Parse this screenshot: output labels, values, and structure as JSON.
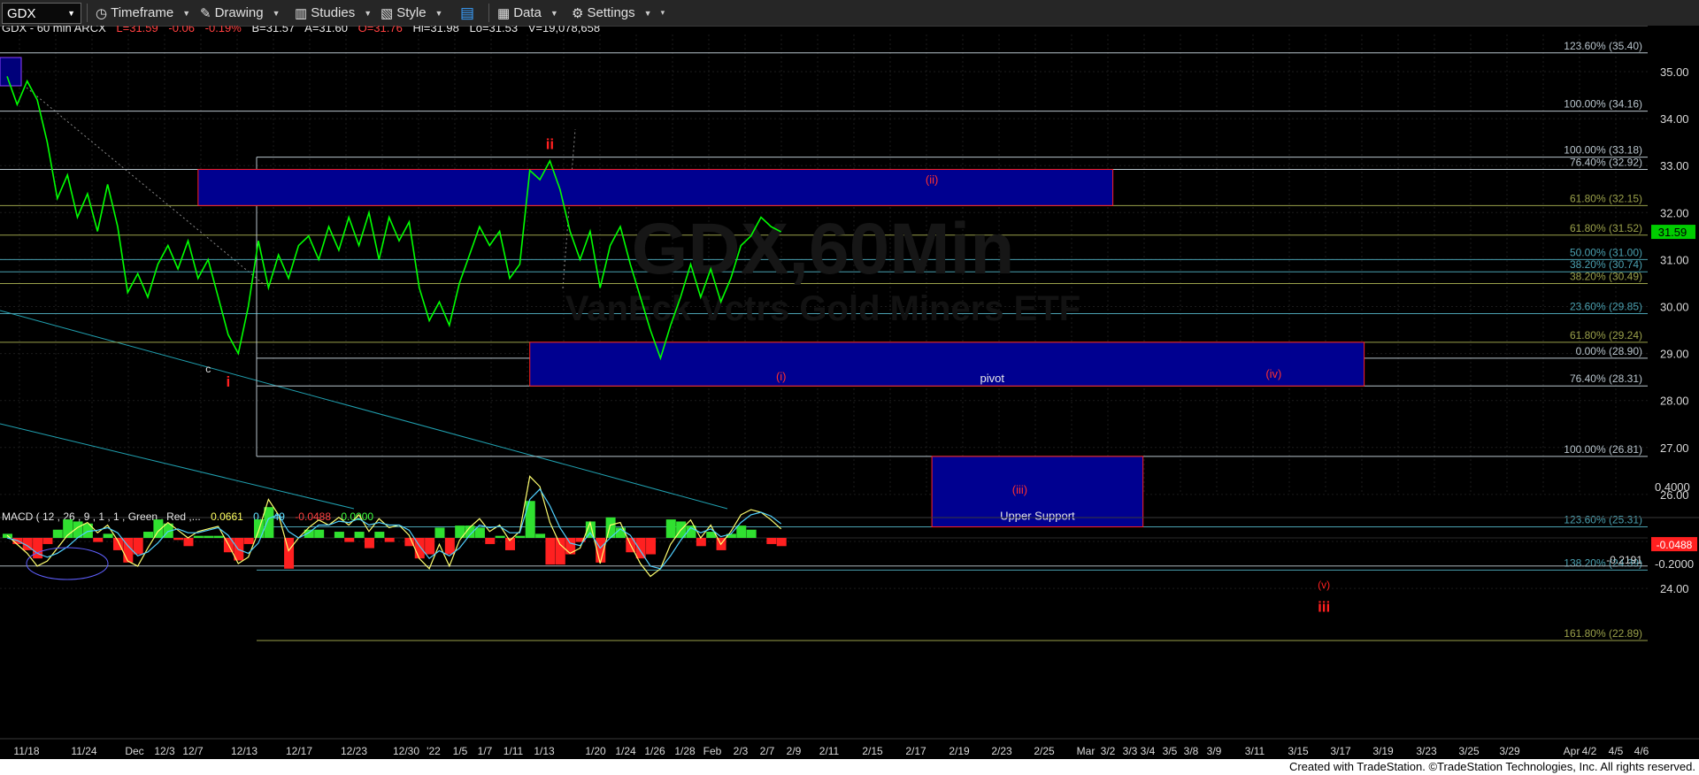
{
  "toolbar": {
    "symbol": "GDX",
    "timeframe_label": "Timeframe",
    "drawing_label": "Drawing",
    "studies_label": "Studies",
    "style_label": "Style",
    "data_label": "Data",
    "settings_label": "Settings"
  },
  "header": {
    "name": "GDX - 60 min  ARCX",
    "last": "L=31.59",
    "change": "-0.06",
    "change_pct": "-0.19%",
    "bid": "B=31.57",
    "ask": "A=31.60",
    "open": "O=31.76",
    "high": "Hi=31.98",
    "low": "Lo=31.53",
    "volume": "V=19,078,658"
  },
  "watermark": {
    "line1": "GDX,60Min",
    "line2": "VanEck Vctrs Gold Miners ETF"
  },
  "colors": {
    "price": "#00ff00",
    "zone_fill": "#000090",
    "zone_border": "#ff2020",
    "wave_label": "#ff2020",
    "last_badge": "#00cc00"
  },
  "chart_data": {
    "type": "line",
    "title": "GDX - 60 min",
    "price_ticks": [
      "35.00",
      "34.00",
      "33.00",
      "32.00",
      "31.00",
      "30.00",
      "29.00",
      "28.00",
      "27.00",
      "26.00",
      "25.00",
      "24.00"
    ],
    "ylim": [
      22.6,
      35.7
    ],
    "last_price": "31.59",
    "x_ticks": [
      "11/18",
      "11/24",
      "Dec",
      "12/3",
      "12/7",
      "12/13",
      "12/17",
      "12/23",
      "12/30",
      "'22",
      "1/5",
      "1/7",
      "1/11",
      "1/13",
      "1/20",
      "1/24",
      "1/26",
      "1/28",
      "Feb",
      "2/3",
      "2/7",
      "2/9",
      "2/11",
      "2/15",
      "2/17",
      "2/19",
      "2/23",
      "2/25",
      "Mar",
      "3/2",
      "3/3",
      "3/4",
      "3/5",
      "3/8",
      "3/9",
      "3/11",
      "3/15",
      "3/17",
      "3/19",
      "3/23",
      "3/25",
      "3/29",
      "Apr",
      "4/2",
      "4/5",
      "4/6"
    ],
    "price_series": [
      {
        "t": 0,
        "v": 34.9
      },
      {
        "t": 1,
        "v": 34.3
      },
      {
        "t": 2,
        "v": 34.8
      },
      {
        "t": 3,
        "v": 34.4
      },
      {
        "t": 4,
        "v": 33.5
      },
      {
        "t": 5,
        "v": 32.3
      },
      {
        "t": 6,
        "v": 32.8
      },
      {
        "t": 7,
        "v": 31.9
      },
      {
        "t": 8,
        "v": 32.4
      },
      {
        "t": 9,
        "v": 31.6
      },
      {
        "t": 10,
        "v": 32.6
      },
      {
        "t": 11,
        "v": 31.7
      },
      {
        "t": 12,
        "v": 30.3
      },
      {
        "t": 13,
        "v": 30.7
      },
      {
        "t": 14,
        "v": 30.2
      },
      {
        "t": 15,
        "v": 30.9
      },
      {
        "t": 16,
        "v": 31.3
      },
      {
        "t": 17,
        "v": 30.8
      },
      {
        "t": 18,
        "v": 31.4
      },
      {
        "t": 19,
        "v": 30.6
      },
      {
        "t": 20,
        "v": 31.0
      },
      {
        "t": 21,
        "v": 30.2
      },
      {
        "t": 22,
        "v": 29.4
      },
      {
        "t": 23,
        "v": 29.0
      },
      {
        "t": 24,
        "v": 30.0
      },
      {
        "t": 25,
        "v": 31.4
      },
      {
        "t": 26,
        "v": 30.4
      },
      {
        "t": 27,
        "v": 31.1
      },
      {
        "t": 28,
        "v": 30.6
      },
      {
        "t": 29,
        "v": 31.3
      },
      {
        "t": 30,
        "v": 31.5
      },
      {
        "t": 31,
        "v": 31.0
      },
      {
        "t": 32,
        "v": 31.7
      },
      {
        "t": 33,
        "v": 31.2
      },
      {
        "t": 34,
        "v": 31.9
      },
      {
        "t": 35,
        "v": 31.3
      },
      {
        "t": 36,
        "v": 32.0
      },
      {
        "t": 37,
        "v": 31.0
      },
      {
        "t": 38,
        "v": 31.9
      },
      {
        "t": 39,
        "v": 31.4
      },
      {
        "t": 40,
        "v": 31.8
      },
      {
        "t": 41,
        "v": 30.4
      },
      {
        "t": 42,
        "v": 29.7
      },
      {
        "t": 43,
        "v": 30.1
      },
      {
        "t": 44,
        "v": 29.6
      },
      {
        "t": 45,
        "v": 30.5
      },
      {
        "t": 46,
        "v": 31.1
      },
      {
        "t": 47,
        "v": 31.7
      },
      {
        "t": 48,
        "v": 31.3
      },
      {
        "t": 49,
        "v": 31.6
      },
      {
        "t": 50,
        "v": 30.6
      },
      {
        "t": 51,
        "v": 30.9
      },
      {
        "t": 52,
        "v": 32.9
      },
      {
        "t": 53,
        "v": 32.7
      },
      {
        "t": 54,
        "v": 33.1
      },
      {
        "t": 55,
        "v": 32.5
      },
      {
        "t": 56,
        "v": 31.6
      },
      {
        "t": 57,
        "v": 31.0
      },
      {
        "t": 58,
        "v": 31.6
      },
      {
        "t": 59,
        "v": 30.4
      },
      {
        "t": 60,
        "v": 31.3
      },
      {
        "t": 61,
        "v": 31.7
      },
      {
        "t": 62,
        "v": 30.9
      },
      {
        "t": 63,
        "v": 30.2
      },
      {
        "t": 64,
        "v": 29.5
      },
      {
        "t": 65,
        "v": 28.9
      },
      {
        "t": 66,
        "v": 29.6
      },
      {
        "t": 67,
        "v": 30.2
      },
      {
        "t": 68,
        "v": 30.9
      },
      {
        "t": 69,
        "v": 30.2
      },
      {
        "t": 70,
        "v": 30.8
      },
      {
        "t": 71,
        "v": 30.1
      },
      {
        "t": 72,
        "v": 30.6
      },
      {
        "t": 73,
        "v": 31.3
      },
      {
        "t": 74,
        "v": 31.5
      },
      {
        "t": 75,
        "v": 31.9
      },
      {
        "t": 76,
        "v": 31.7
      },
      {
        "t": 77,
        "v": 31.59
      }
    ],
    "fib_levels": [
      {
        "label": "123.60% (35.40)",
        "price": 35.4,
        "color": "#b8c4cc"
      },
      {
        "label": "100.00% (34.16)",
        "price": 34.16,
        "color": "#b8c4cc"
      },
      {
        "label": "100.00% (33.18)",
        "price": 33.18,
        "color": "#b8c4cc"
      },
      {
        "label": "76.40% (32.92)",
        "price": 32.92,
        "color": "#b8c4cc"
      },
      {
        "label": "61.80% (32.15)",
        "price": 32.15,
        "color": "#9aa04a"
      },
      {
        "label": "61.80% (31.52)",
        "price": 31.52,
        "color": "#9aa04a"
      },
      {
        "label": "50.00% (31.00)",
        "price": 31.0,
        "color": "#4aa0b0"
      },
      {
        "label": "38.20% (30.74)",
        "price": 30.74,
        "color": "#4aa0b0"
      },
      {
        "label": "38.20% (30.49)",
        "price": 30.49,
        "color": "#9aa04a"
      },
      {
        "label": "23.60% (29.85)",
        "price": 29.85,
        "color": "#4aa0b0"
      },
      {
        "label": "61.80% (29.24)",
        "price": 29.24,
        "color": "#9aa04a"
      },
      {
        "label": "0.00% (28.90)",
        "price": 28.9,
        "color": "#b8c4cc"
      },
      {
        "label": "76.40% (28.31)",
        "price": 28.31,
        "color": "#b8c4cc"
      },
      {
        "label": "100.00% (26.81)",
        "price": 26.81,
        "color": "#b8c4cc"
      },
      {
        "label": "123.60% (25.31)",
        "price": 25.31,
        "color": "#4aa0b0"
      },
      {
        "label": "138.20% (24.39)",
        "price": 24.39,
        "color": "#4aa0b0"
      },
      {
        "label": "161.80% (22.89)",
        "price": 22.89,
        "color": "#9aa04a"
      }
    ],
    "zones": [
      {
        "name": "wave-ii-zone",
        "label": "(ii)",
        "top": 32.92,
        "bottom": 32.15,
        "t_start": 19,
        "t_end": 110
      },
      {
        "name": "pivot-zone",
        "label": "pivot",
        "sublabel_i": "(i)",
        "sublabel_iv": "(iv)",
        "top": 29.24,
        "bottom": 28.31,
        "t_start": 52,
        "t_end": 135
      },
      {
        "name": "upper-support-zone",
        "label": "Upper Support",
        "sublabel": "(iii)",
        "top": 26.81,
        "bottom": 25.31,
        "t_start": 92,
        "t_end": 113
      }
    ],
    "wave_labels": [
      {
        "text": "ii",
        "price": 33.35,
        "t": 54,
        "bold": true
      },
      {
        "text": "i",
        "price": 28.3,
        "t": 22,
        "bold": true
      },
      {
        "text": "c",
        "price": 28.6,
        "t": 20,
        "bold": false
      },
      {
        "text": "(v)",
        "price": 24.0,
        "t": 131,
        "bold": false
      },
      {
        "text": "iii",
        "price": 23.5,
        "t": 131,
        "bold": true
      }
    ],
    "macd": {
      "label": "MACD ( 12 , 26 , 9 , 1 , 1 , Green , Red ,...",
      "macd_value": "0.0661",
      "signal_value": "0.1149",
      "hist_value": "-0.0488",
      "zero_value": "0.0000",
      "ticks": [
        "0.4000",
        "-0.2000"
      ],
      "annot_label": "-0.2191",
      "ylim": [
        -0.35,
        0.5
      ],
      "line": [
        0.02,
        -0.05,
        -0.12,
        -0.22,
        -0.18,
        -0.08,
        0.02,
        0.08,
        0.12,
        0.04,
        0.1,
        -0.02,
        -0.18,
        -0.22,
        -0.08,
        0.05,
        0.12,
        0.06,
        0.0,
        0.05,
        0.07,
        0.09,
        -0.05,
        -0.2,
        -0.15,
        0.05,
        0.3,
        0.18,
        -0.1,
        0.0,
        0.08,
        0.14,
        0.1,
        0.16,
        0.1,
        0.18,
        0.05,
        0.15,
        0.08,
        0.1,
        0.02,
        -0.16,
        -0.24,
        -0.05,
        -0.22,
        -0.02,
        0.08,
        0.15,
        0.05,
        0.1,
        -0.02,
        0.05,
        0.48,
        0.4,
        0.12,
        -0.05,
        -0.12,
        -0.08,
        0.12,
        -0.2,
        0.1,
        0.12,
        -0.05,
        -0.2,
        -0.3,
        -0.24,
        -0.05,
        0.06,
        0.14,
        0.0,
        0.1,
        -0.05,
        0.05,
        0.18,
        0.22,
        0.2,
        0.14,
        0.07
      ],
      "signal": [
        0.0,
        -0.02,
        -0.06,
        -0.12,
        -0.15,
        -0.12,
        -0.07,
        0.0,
        0.05,
        0.06,
        0.08,
        0.04,
        -0.06,
        -0.14,
        -0.11,
        -0.04,
        0.05,
        0.07,
        0.04,
        0.04,
        0.06,
        0.08,
        0.02,
        -0.09,
        -0.12,
        -0.04,
        0.15,
        0.18,
        0.05,
        0.0,
        0.04,
        0.1,
        0.1,
        0.13,
        0.12,
        0.15,
        0.1,
        0.12,
        0.1,
        0.1,
        0.06,
        -0.06,
        -0.16,
        -0.1,
        -0.14,
        -0.08,
        0.02,
        0.1,
        0.08,
        0.09,
        0.04,
        0.04,
        0.3,
        0.38,
        0.25,
        0.08,
        -0.04,
        -0.06,
        0.04,
        -0.08,
        0.0,
        0.07,
        0.02,
        -0.1,
        -0.22,
        -0.24,
        -0.14,
        -0.02,
        0.08,
        0.04,
        0.07,
        0.01,
        0.03,
        0.12,
        0.18,
        0.2,
        0.17,
        0.11
      ]
    }
  },
  "footer": {
    "credit": "Created with TradeStation. ©TradeStation Technologies, Inc. All rights reserved."
  }
}
